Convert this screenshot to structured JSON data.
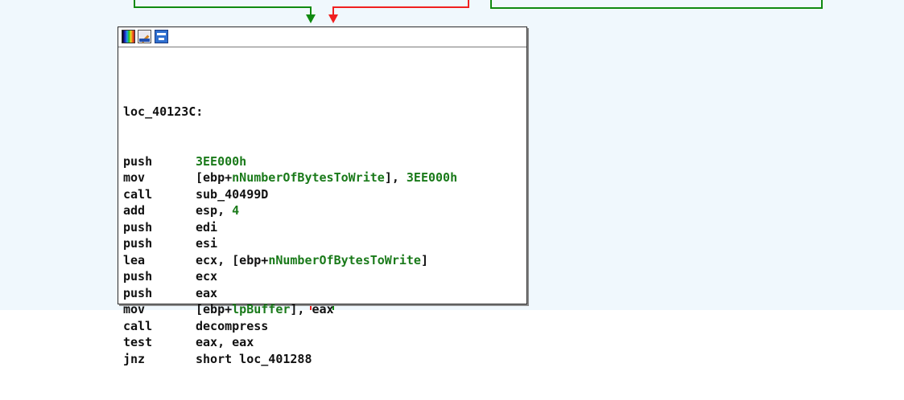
{
  "colors": {
    "background": "#f0f8fd",
    "edge_true": "#108a10",
    "edge_false": "#f02020",
    "operand_symbol": "#1a7a1a",
    "text": "#111111"
  },
  "node_toolbar": {
    "icons": [
      "color-palette-icon",
      "edit-node-icon",
      "graph-view-icon"
    ]
  },
  "block": {
    "label": "loc_40123C:",
    "instructions": [
      {
        "mnemonic": "push",
        "parts": [
          {
            "t": "3EE000h",
            "c": "g"
          }
        ]
      },
      {
        "mnemonic": "mov",
        "parts": [
          {
            "t": "[ebp+",
            "c": "n"
          },
          {
            "t": "nNumberOfBytesToWrite",
            "c": "g"
          },
          {
            "t": "], ",
            "c": "n"
          },
          {
            "t": "3EE000h",
            "c": "g"
          }
        ]
      },
      {
        "mnemonic": "call",
        "parts": [
          {
            "t": "sub_40499D",
            "c": "n"
          }
        ]
      },
      {
        "mnemonic": "add",
        "parts": [
          {
            "t": "esp, ",
            "c": "n"
          },
          {
            "t": "4",
            "c": "g"
          }
        ]
      },
      {
        "mnemonic": "push",
        "parts": [
          {
            "t": "edi",
            "c": "n"
          }
        ]
      },
      {
        "mnemonic": "push",
        "parts": [
          {
            "t": "esi",
            "c": "n"
          }
        ]
      },
      {
        "mnemonic": "lea",
        "parts": [
          {
            "t": "ecx, [ebp+",
            "c": "n"
          },
          {
            "t": "nNumberOfBytesToWrite",
            "c": "g"
          },
          {
            "t": "]",
            "c": "n"
          }
        ]
      },
      {
        "mnemonic": "push",
        "parts": [
          {
            "t": "ecx",
            "c": "n"
          }
        ]
      },
      {
        "mnemonic": "push",
        "parts": [
          {
            "t": "eax",
            "c": "n"
          }
        ]
      },
      {
        "mnemonic": "mov",
        "parts": [
          {
            "t": "[ebp+",
            "c": "n"
          },
          {
            "t": "lpBuffer",
            "c": "g"
          },
          {
            "t": "], eax",
            "c": "n"
          }
        ]
      },
      {
        "mnemonic": "call",
        "parts": [
          {
            "t": "decompress",
            "c": "n"
          }
        ]
      },
      {
        "mnemonic": "test",
        "parts": [
          {
            "t": "eax, eax",
            "c": "n"
          }
        ]
      },
      {
        "mnemonic": "jnz",
        "parts": [
          {
            "t": "short loc_401288",
            "c": "n"
          }
        ]
      }
    ]
  }
}
